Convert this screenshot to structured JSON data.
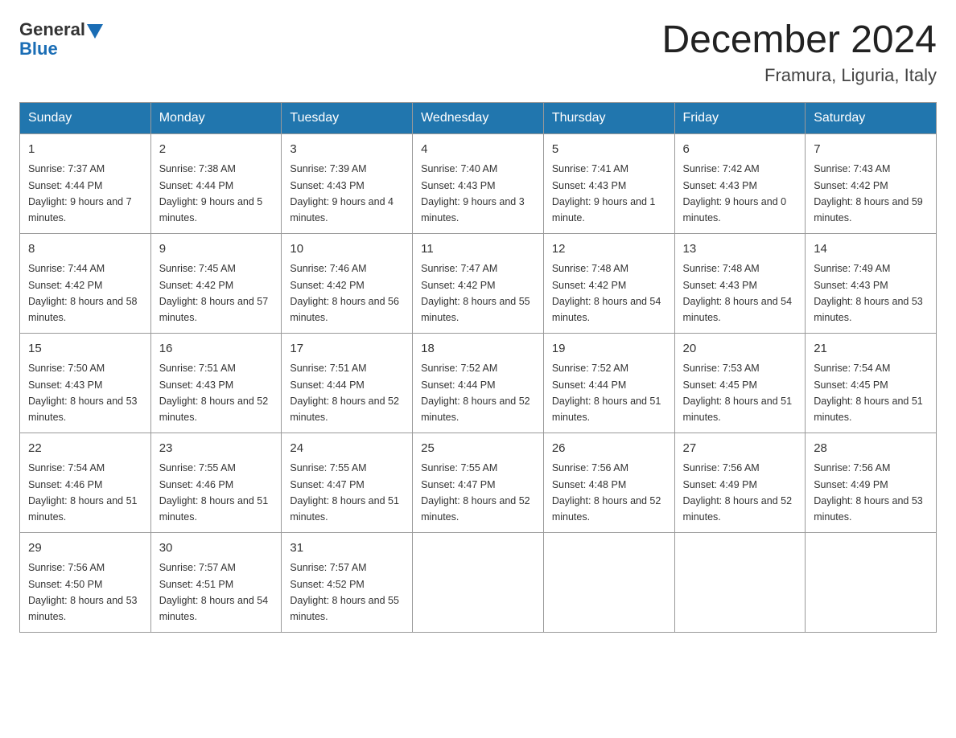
{
  "header": {
    "logo_general": "General",
    "logo_blue": "Blue",
    "month_title": "December 2024",
    "location": "Framura, Liguria, Italy"
  },
  "days_of_week": [
    "Sunday",
    "Monday",
    "Tuesday",
    "Wednesday",
    "Thursday",
    "Friday",
    "Saturday"
  ],
  "weeks": [
    [
      {
        "day": "1",
        "sunrise": "7:37 AM",
        "sunset": "4:44 PM",
        "daylight": "9 hours and 7 minutes."
      },
      {
        "day": "2",
        "sunrise": "7:38 AM",
        "sunset": "4:44 PM",
        "daylight": "9 hours and 5 minutes."
      },
      {
        "day": "3",
        "sunrise": "7:39 AM",
        "sunset": "4:43 PM",
        "daylight": "9 hours and 4 minutes."
      },
      {
        "day": "4",
        "sunrise": "7:40 AM",
        "sunset": "4:43 PM",
        "daylight": "9 hours and 3 minutes."
      },
      {
        "day": "5",
        "sunrise": "7:41 AM",
        "sunset": "4:43 PM",
        "daylight": "9 hours and 1 minute."
      },
      {
        "day": "6",
        "sunrise": "7:42 AM",
        "sunset": "4:43 PM",
        "daylight": "9 hours and 0 minutes."
      },
      {
        "day": "7",
        "sunrise": "7:43 AM",
        "sunset": "4:42 PM",
        "daylight": "8 hours and 59 minutes."
      }
    ],
    [
      {
        "day": "8",
        "sunrise": "7:44 AM",
        "sunset": "4:42 PM",
        "daylight": "8 hours and 58 minutes."
      },
      {
        "day": "9",
        "sunrise": "7:45 AM",
        "sunset": "4:42 PM",
        "daylight": "8 hours and 57 minutes."
      },
      {
        "day": "10",
        "sunrise": "7:46 AM",
        "sunset": "4:42 PM",
        "daylight": "8 hours and 56 minutes."
      },
      {
        "day": "11",
        "sunrise": "7:47 AM",
        "sunset": "4:42 PM",
        "daylight": "8 hours and 55 minutes."
      },
      {
        "day": "12",
        "sunrise": "7:48 AM",
        "sunset": "4:42 PM",
        "daylight": "8 hours and 54 minutes."
      },
      {
        "day": "13",
        "sunrise": "7:48 AM",
        "sunset": "4:43 PM",
        "daylight": "8 hours and 54 minutes."
      },
      {
        "day": "14",
        "sunrise": "7:49 AM",
        "sunset": "4:43 PM",
        "daylight": "8 hours and 53 minutes."
      }
    ],
    [
      {
        "day": "15",
        "sunrise": "7:50 AM",
        "sunset": "4:43 PM",
        "daylight": "8 hours and 53 minutes."
      },
      {
        "day": "16",
        "sunrise": "7:51 AM",
        "sunset": "4:43 PM",
        "daylight": "8 hours and 52 minutes."
      },
      {
        "day": "17",
        "sunrise": "7:51 AM",
        "sunset": "4:44 PM",
        "daylight": "8 hours and 52 minutes."
      },
      {
        "day": "18",
        "sunrise": "7:52 AM",
        "sunset": "4:44 PM",
        "daylight": "8 hours and 52 minutes."
      },
      {
        "day": "19",
        "sunrise": "7:52 AM",
        "sunset": "4:44 PM",
        "daylight": "8 hours and 51 minutes."
      },
      {
        "day": "20",
        "sunrise": "7:53 AM",
        "sunset": "4:45 PM",
        "daylight": "8 hours and 51 minutes."
      },
      {
        "day": "21",
        "sunrise": "7:54 AM",
        "sunset": "4:45 PM",
        "daylight": "8 hours and 51 minutes."
      }
    ],
    [
      {
        "day": "22",
        "sunrise": "7:54 AM",
        "sunset": "4:46 PM",
        "daylight": "8 hours and 51 minutes."
      },
      {
        "day": "23",
        "sunrise": "7:55 AM",
        "sunset": "4:46 PM",
        "daylight": "8 hours and 51 minutes."
      },
      {
        "day": "24",
        "sunrise": "7:55 AM",
        "sunset": "4:47 PM",
        "daylight": "8 hours and 51 minutes."
      },
      {
        "day": "25",
        "sunrise": "7:55 AM",
        "sunset": "4:47 PM",
        "daylight": "8 hours and 52 minutes."
      },
      {
        "day": "26",
        "sunrise": "7:56 AM",
        "sunset": "4:48 PM",
        "daylight": "8 hours and 52 minutes."
      },
      {
        "day": "27",
        "sunrise": "7:56 AM",
        "sunset": "4:49 PM",
        "daylight": "8 hours and 52 minutes."
      },
      {
        "day": "28",
        "sunrise": "7:56 AM",
        "sunset": "4:49 PM",
        "daylight": "8 hours and 53 minutes."
      }
    ],
    [
      {
        "day": "29",
        "sunrise": "7:56 AM",
        "sunset": "4:50 PM",
        "daylight": "8 hours and 53 minutes."
      },
      {
        "day": "30",
        "sunrise": "7:57 AM",
        "sunset": "4:51 PM",
        "daylight": "8 hours and 54 minutes."
      },
      {
        "day": "31",
        "sunrise": "7:57 AM",
        "sunset": "4:52 PM",
        "daylight": "8 hours and 55 minutes."
      },
      null,
      null,
      null,
      null
    ]
  ],
  "labels": {
    "sunrise": "Sunrise:",
    "sunset": "Sunset:",
    "daylight": "Daylight:"
  }
}
